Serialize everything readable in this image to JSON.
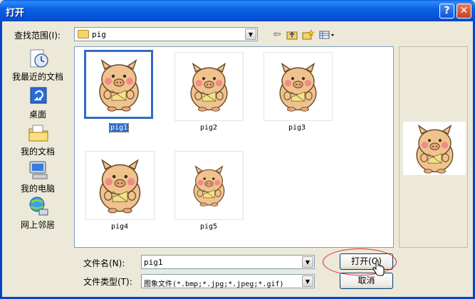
{
  "window": {
    "title": "打开",
    "help_glyph": "?",
    "close_glyph": "✕"
  },
  "lookin": {
    "label": "查找范围(I):",
    "value": "pig"
  },
  "toolbar": [
    "back-icon",
    "up-folder-icon",
    "new-folder-icon",
    "view-menu-icon"
  ],
  "places": [
    {
      "label": "我最近的文档",
      "icon": "recent-documents-icon"
    },
    {
      "label": "桌面",
      "icon": "desktop-icon"
    },
    {
      "label": "我的文档",
      "icon": "my-documents-icon"
    },
    {
      "label": "我的电脑",
      "icon": "my-computer-icon"
    },
    {
      "label": "网上邻居",
      "icon": "network-places-icon"
    }
  ],
  "files": [
    {
      "name": "pig1",
      "selected": true
    },
    {
      "name": "pig2",
      "selected": false
    },
    {
      "name": "pig3",
      "selected": false
    },
    {
      "name": "pig4",
      "selected": false
    },
    {
      "name": "pig5",
      "selected": false
    }
  ],
  "filename": {
    "label": "文件名(N):",
    "value": "pig1"
  },
  "filetype": {
    "label": "文件类型(T):",
    "value": "图象文件(*.bmp;*.jpg;*.jpeg;*.gif)"
  },
  "buttons": {
    "open": "打开(O)",
    "cancel": "取消"
  },
  "colors": {
    "title_bar": "#0a63e6",
    "selection": "#316ac5",
    "annotation": "#e0202c",
    "pig_body": "#f0c38e"
  }
}
